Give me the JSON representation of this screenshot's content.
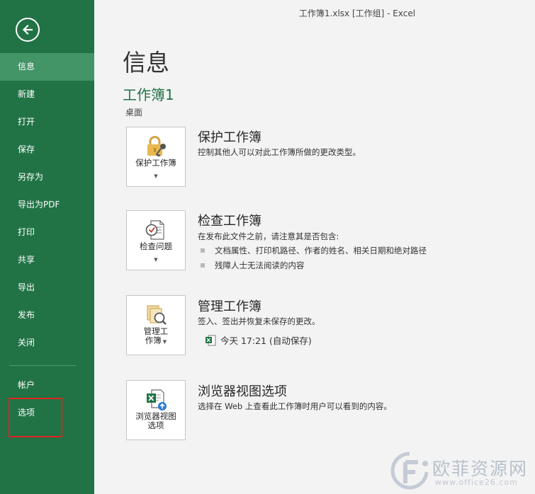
{
  "window": {
    "title": "工作簿1.xlsx  [工作组] - Excel"
  },
  "sidebar": {
    "items": [
      {
        "label": "信息",
        "active": true
      },
      {
        "label": "新建"
      },
      {
        "label": "打开"
      },
      {
        "label": "保存"
      },
      {
        "label": "另存为"
      },
      {
        "label": "导出为PDF"
      },
      {
        "label": "打印"
      },
      {
        "label": "共享"
      },
      {
        "label": "导出"
      },
      {
        "label": "发布"
      },
      {
        "label": "关闭"
      }
    ],
    "bottom_items": [
      {
        "label": "帐户"
      },
      {
        "label": "选项"
      }
    ]
  },
  "main": {
    "title": "信息",
    "document_name": "工作簿1",
    "location": "桌面",
    "protect": {
      "tile_label": "保护工作簿",
      "title": "保护工作簿",
      "description": "控制其他人可以对此工作簿所做的更改类型。"
    },
    "inspect": {
      "tile_label": "检查问题",
      "title": "检查工作簿",
      "description": "在发布此文件之前，请注意其是否包含:",
      "bullets": [
        "文档属性、打印机路径、作者的姓名、相关日期和绝对路径",
        "残障人士无法阅读的内容"
      ]
    },
    "manage": {
      "tile_label_line1": "管理工",
      "tile_label_line2": "作簿",
      "title": "管理工作簿",
      "description": "签入、签出并恢复未保存的更改。",
      "version": "今天 17:21 (自动保存)"
    },
    "browser": {
      "tile_label_line1": "浏览器视图",
      "tile_label_line2": "选项",
      "title": "浏览器视图选项",
      "description": "选择在 Web 上查看此工作簿时用户可以看到的内容。"
    }
  },
  "watermark": {
    "text": "欧菲资源网",
    "url": "www.office26.com"
  },
  "colors": {
    "sidebar": "#217346",
    "sidebar_active": "#439467",
    "accent": "#217346",
    "highlight_box": "#e0221e"
  },
  "icons": {
    "back": "back-arrow-icon",
    "protect": "lock-key-icon",
    "inspect": "inspect-document-icon",
    "manage": "manage-versions-icon",
    "browser": "excel-web-icon"
  }
}
